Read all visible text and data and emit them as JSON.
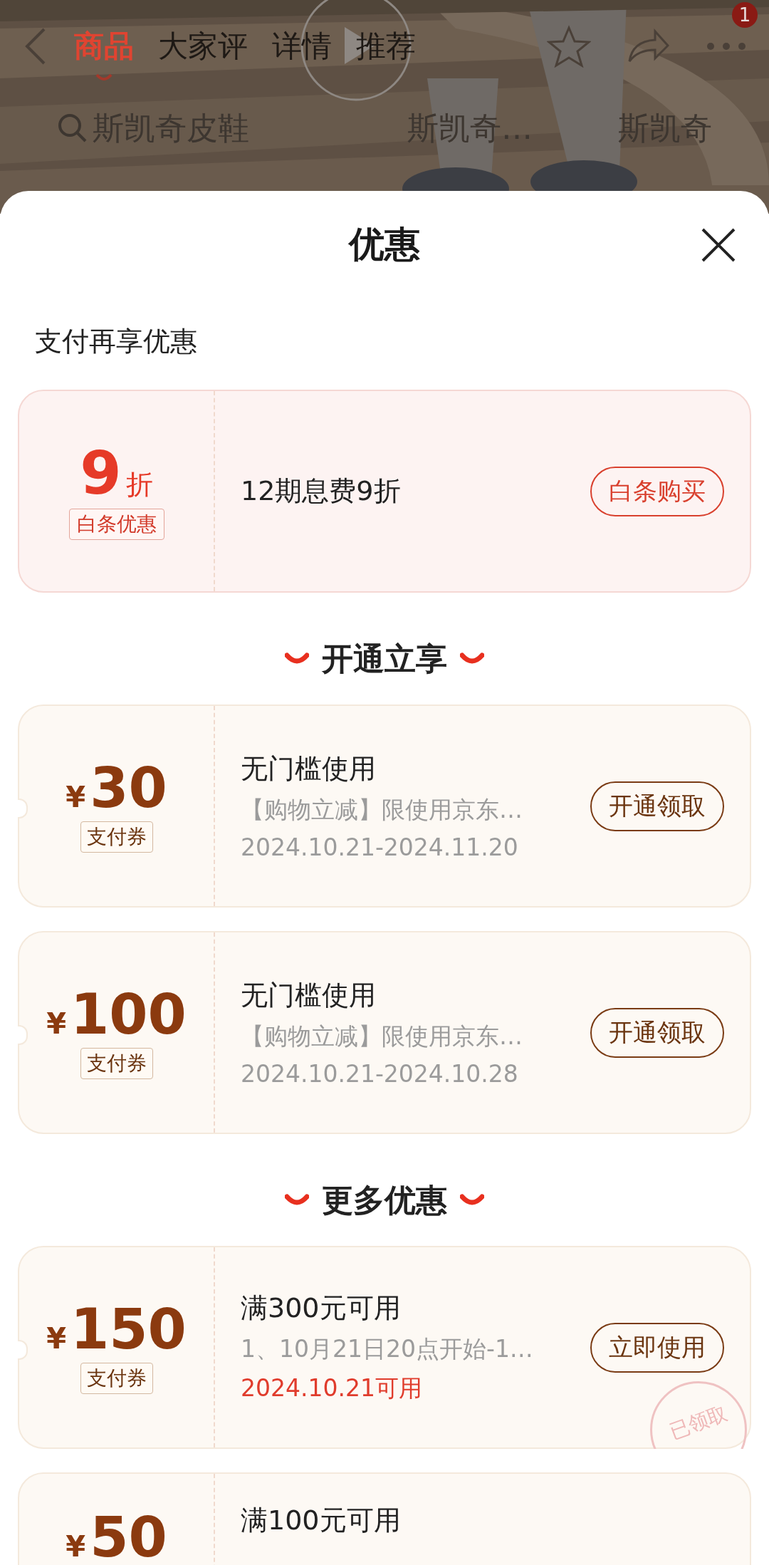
{
  "header": {
    "tabs": [
      {
        "label": "商品",
        "selected": true
      },
      {
        "label": "大家评",
        "selected": false
      },
      {
        "label": "详情",
        "selected": false
      },
      {
        "label": "推荐",
        "selected": false
      }
    ],
    "cart_badge": "1",
    "search_suggestions": [
      {
        "text": "斯凯奇皮鞋"
      },
      {
        "text": "斯凯奇…"
      },
      {
        "text": "斯凯奇"
      }
    ]
  },
  "sheet": {
    "title": "优惠",
    "sections": [
      {
        "heading": "支付再享优惠",
        "offers": [
          {
            "kind": "discount",
            "amount": "9",
            "unit": "折",
            "tag": "白条优惠",
            "title": "12期息费9折",
            "button": "白条购买"
          }
        ]
      },
      {
        "heading": "开通立享",
        "offers": [
          {
            "kind": "coupon",
            "currency": "¥",
            "amount": "30",
            "tag": "支付券",
            "title": "无门槛使用",
            "detail": "【购物立减】限使用京东…",
            "validity": "2024.10.21-2024.11.20",
            "validity_highlight": false,
            "button": "开通领取"
          },
          {
            "kind": "coupon",
            "currency": "¥",
            "amount": "100",
            "tag": "支付券",
            "title": "无门槛使用",
            "detail": "【购物立减】限使用京东…",
            "validity": "2024.10.21-2024.10.28",
            "validity_highlight": false,
            "button": "开通领取"
          }
        ]
      },
      {
        "heading": "更多优惠",
        "offers": [
          {
            "kind": "coupon",
            "currency": "¥",
            "amount": "150",
            "tag": "支付券",
            "title": "满300元可用",
            "detail": "1、10月21日20点开始-1…",
            "validity": "2024.10.21可用",
            "validity_highlight": true,
            "button": "立即使用",
            "stamp": "已领取"
          },
          {
            "kind": "coupon",
            "currency": "¥",
            "amount": "50",
            "title": "满100元可用"
          }
        ]
      }
    ]
  }
}
